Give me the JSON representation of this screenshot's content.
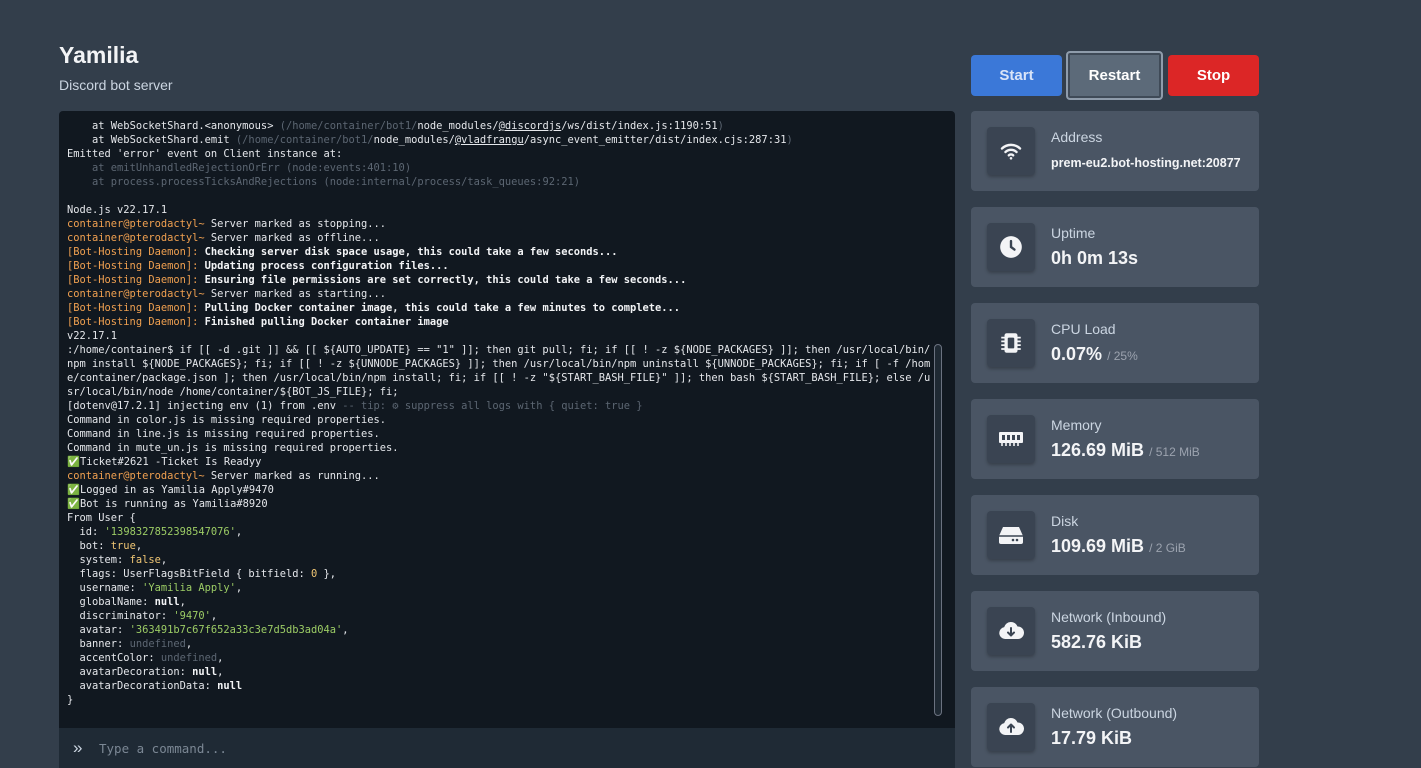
{
  "server": {
    "name": "Yamilia",
    "description": "Discord bot server"
  },
  "controls": {
    "start": "Start",
    "restart": "Restart",
    "stop": "Stop"
  },
  "console": {
    "lines": [
      [
        {
          "t": "    at WebSocketShard.<anonymous> "
        },
        {
          "t": "(/home/container/bot1/",
          "c": "c-dim"
        },
        {
          "t": "node_modules/"
        },
        {
          "t": "@discordjs",
          "c": "c-under"
        },
        {
          "t": "/ws/dist/index.js:1190:51"
        },
        {
          "t": ")",
          "c": "c-dim"
        }
      ],
      [
        {
          "t": "    at WebSocketShard.emit "
        },
        {
          "t": "(/home/container/bot1/",
          "c": "c-dim"
        },
        {
          "t": "node_modules/"
        },
        {
          "t": "@vladfrangu",
          "c": "c-under"
        },
        {
          "t": "/async_event_emitter/dist/index.cjs:287:31"
        },
        {
          "t": ")",
          "c": "c-dim"
        }
      ],
      [
        {
          "t": "Emitted 'error' event on Client instance at:"
        }
      ],
      [
        {
          "t": "    at emitUnhandledRejectionOrErr (node:events:401:10)",
          "c": "c-dim"
        }
      ],
      [
        {
          "t": "    at process.processTicksAndRejections (node:internal/process/task_queues:92:21)",
          "c": "c-dim"
        }
      ],
      [
        {
          "t": ""
        }
      ],
      [
        {
          "t": "Node.js v22.17.1"
        }
      ],
      [
        {
          "t": "container@pterodactyl~",
          "c": "c-orange"
        },
        {
          "t": " Server marked as stopping..."
        }
      ],
      [
        {
          "t": "container@pterodactyl~",
          "c": "c-orange"
        },
        {
          "t": " Server marked as offline..."
        }
      ],
      [
        {
          "t": "[Bot-Hosting Daemon]:",
          "c": "c-orange"
        },
        {
          "t": " Checking server disk space usage, this could take a few seconds...",
          "c": "c-bold"
        }
      ],
      [
        {
          "t": "[Bot-Hosting Daemon]:",
          "c": "c-orange"
        },
        {
          "t": " Updating process configuration files...",
          "c": "c-bold"
        }
      ],
      [
        {
          "t": "[Bot-Hosting Daemon]:",
          "c": "c-orange"
        },
        {
          "t": " Ensuring file permissions are set correctly, this could take a few seconds...",
          "c": "c-bold"
        }
      ],
      [
        {
          "t": "container@pterodactyl~",
          "c": "c-orange"
        },
        {
          "t": " Server marked as starting..."
        }
      ],
      [
        {
          "t": "[Bot-Hosting Daemon]:",
          "c": "c-orange"
        },
        {
          "t": " Pulling Docker container image, this could take a few minutes to complete...",
          "c": "c-bold"
        }
      ],
      [
        {
          "t": "[Bot-Hosting Daemon]:",
          "c": "c-orange"
        },
        {
          "t": " Finished pulling Docker container image",
          "c": "c-bold"
        }
      ],
      [
        {
          "t": "v22.17.1"
        }
      ],
      [
        {
          "t": ":/home/container$ if [[ -d .git ]] && [[ ${AUTO_UPDATE} == \"1\" ]]; then git pull; fi; if [[ ! -z ${NODE_PACKAGES} ]]; then /usr/local/bin/npm install ${NODE_PACKAGES}; fi; if [[ ! -z ${UNNODE_PACKAGES} ]]; then /usr/local/bin/npm uninstall ${UNNODE_PACKAGES}; fi; if [ -f /home/container/package.json ]; then /usr/local/bin/npm install; fi; if [[ ! -z \"${START_BASH_FILE}\" ]]; then bash ${START_BASH_FILE}; else /usr/local/bin/node /home/container/${BOT_JS_FILE}; fi;"
        }
      ],
      [
        {
          "t": "[dotenv@17.2.1] injecting env (1) from .env "
        },
        {
          "t": "-- tip: ⚙ suppress all logs with { quiet: true }",
          "c": "c-dim"
        }
      ],
      [
        {
          "t": "Command in color.js is missing required properties."
        }
      ],
      [
        {
          "t": "Command in line.js is missing required properties."
        }
      ],
      [
        {
          "t": "Command in mute_un.js is missing required properties."
        }
      ],
      [
        {
          "t": "✅Ticket#2621 -Ticket Is Readyy"
        }
      ],
      [
        {
          "t": "container@pterodactyl~",
          "c": "c-orange"
        },
        {
          "t": " Server marked as running..."
        }
      ],
      [
        {
          "t": "✅Logged in as Yamilia Apply#9470"
        }
      ],
      [
        {
          "t": "✅Bot is running as Yamilia#8920"
        }
      ],
      [
        {
          "t": "From User {"
        }
      ],
      [
        {
          "t": "  id: "
        },
        {
          "t": "'1398327852398547076'",
          "c": "c-green"
        },
        {
          "t": ","
        }
      ],
      [
        {
          "t": "  bot: "
        },
        {
          "t": "true",
          "c": "c-yellow"
        },
        {
          "t": ","
        }
      ],
      [
        {
          "t": "  system: "
        },
        {
          "t": "false",
          "c": "c-yellow"
        },
        {
          "t": ","
        }
      ],
      [
        {
          "t": "  flags: UserFlagsBitField { bitfield: "
        },
        {
          "t": "0",
          "c": "c-yellow"
        },
        {
          "t": " },"
        }
      ],
      [
        {
          "t": "  username: "
        },
        {
          "t": "'Yamilia Apply'",
          "c": "c-green"
        },
        {
          "t": ","
        }
      ],
      [
        {
          "t": "  globalName: "
        },
        {
          "t": "null",
          "c": "c-bold"
        },
        {
          "t": ","
        }
      ],
      [
        {
          "t": "  discriminator: "
        },
        {
          "t": "'9470'",
          "c": "c-green"
        },
        {
          "t": ","
        }
      ],
      [
        {
          "t": "  avatar: "
        },
        {
          "t": "'363491b7c67f652a33c3e7d5db3ad04a'",
          "c": "c-green"
        },
        {
          "t": ","
        }
      ],
      [
        {
          "t": "  banner: "
        },
        {
          "t": "undefined",
          "c": "c-dim"
        },
        {
          "t": ","
        }
      ],
      [
        {
          "t": "  accentColor: "
        },
        {
          "t": "undefined",
          "c": "c-dim"
        },
        {
          "t": ","
        }
      ],
      [
        {
          "t": "  avatarDecoration: "
        },
        {
          "t": "null",
          "c": "c-bold"
        },
        {
          "t": ","
        }
      ],
      [
        {
          "t": "  avatarDecorationData: "
        },
        {
          "t": "null",
          "c": "c-bold"
        }
      ],
      [
        {
          "t": "}"
        }
      ]
    ],
    "prompt_icon": "»",
    "command_placeholder": "Type a command..."
  },
  "stats": [
    {
      "icon": "wifi-icon",
      "label": "Address",
      "value": "prem-eu2.bot-hosting.net:20877",
      "limit": ""
    },
    {
      "icon": "clock-icon",
      "label": "Uptime",
      "value": "0h 0m 13s",
      "limit": ""
    },
    {
      "icon": "cpu-icon",
      "label": "CPU Load",
      "value": "0.07%",
      "limit": "/ 25%"
    },
    {
      "icon": "memory-icon",
      "label": "Memory",
      "value": "126.69 MiB",
      "limit": "/ 512 MiB"
    },
    {
      "icon": "disk-icon",
      "label": "Disk",
      "value": "109.69 MiB",
      "limit": "/ 2 GiB"
    },
    {
      "icon": "cloud-download-icon",
      "label": "Network (Inbound)",
      "value": "582.76 KiB",
      "limit": ""
    },
    {
      "icon": "cloud-upload-icon",
      "label": "Network (Outbound)",
      "value": "17.79 KiB",
      "limit": ""
    }
  ]
}
